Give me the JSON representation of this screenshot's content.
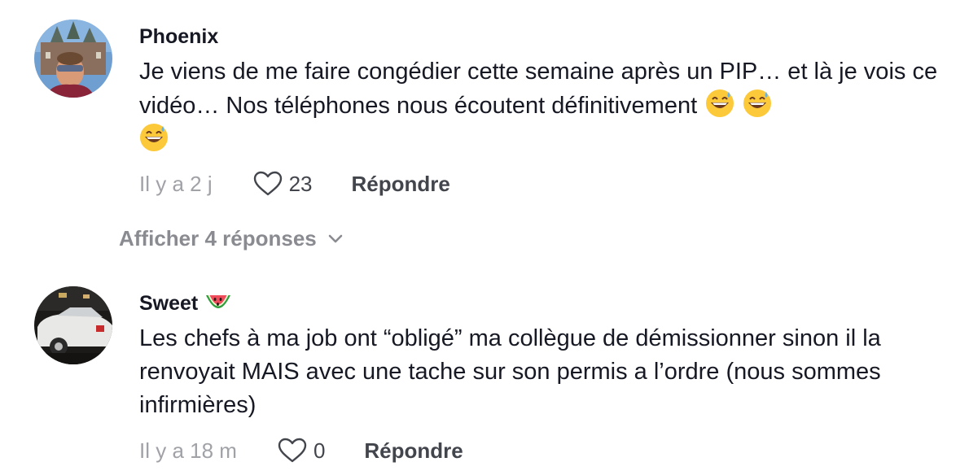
{
  "comments": [
    {
      "username": "Phoenix",
      "text": "Je viens de me faire congédier cette semaine après un PIP… et là je vois ce vidéo… Nos téléphones nous écoutent définitivement",
      "emojis": [
        "grinning-sweat-emoji",
        "grinning-sweat-emoji",
        "grinning-sweat-emoji"
      ],
      "time": "Il y a 2 j",
      "likes": "23",
      "reply_label": "Répondre",
      "view_replies_label": "Afficher 4 réponses"
    },
    {
      "username": "Sweet",
      "username_emoji": "watermelon-emoji",
      "text": "Les chefs à ma job ont “obligé” ma collègue de démissionner sinon il la renvoyait MAIS avec une tache sur son permis a l’ordre (nous sommes infirmières)",
      "time": "Il y a 18 m",
      "likes": "0",
      "reply_label": "Répondre"
    }
  ],
  "colors": {
    "primary_text": "#161823",
    "secondary_text": "#a1a2a7",
    "action_text": "#43454d",
    "view_replies": "#8a8b91"
  }
}
